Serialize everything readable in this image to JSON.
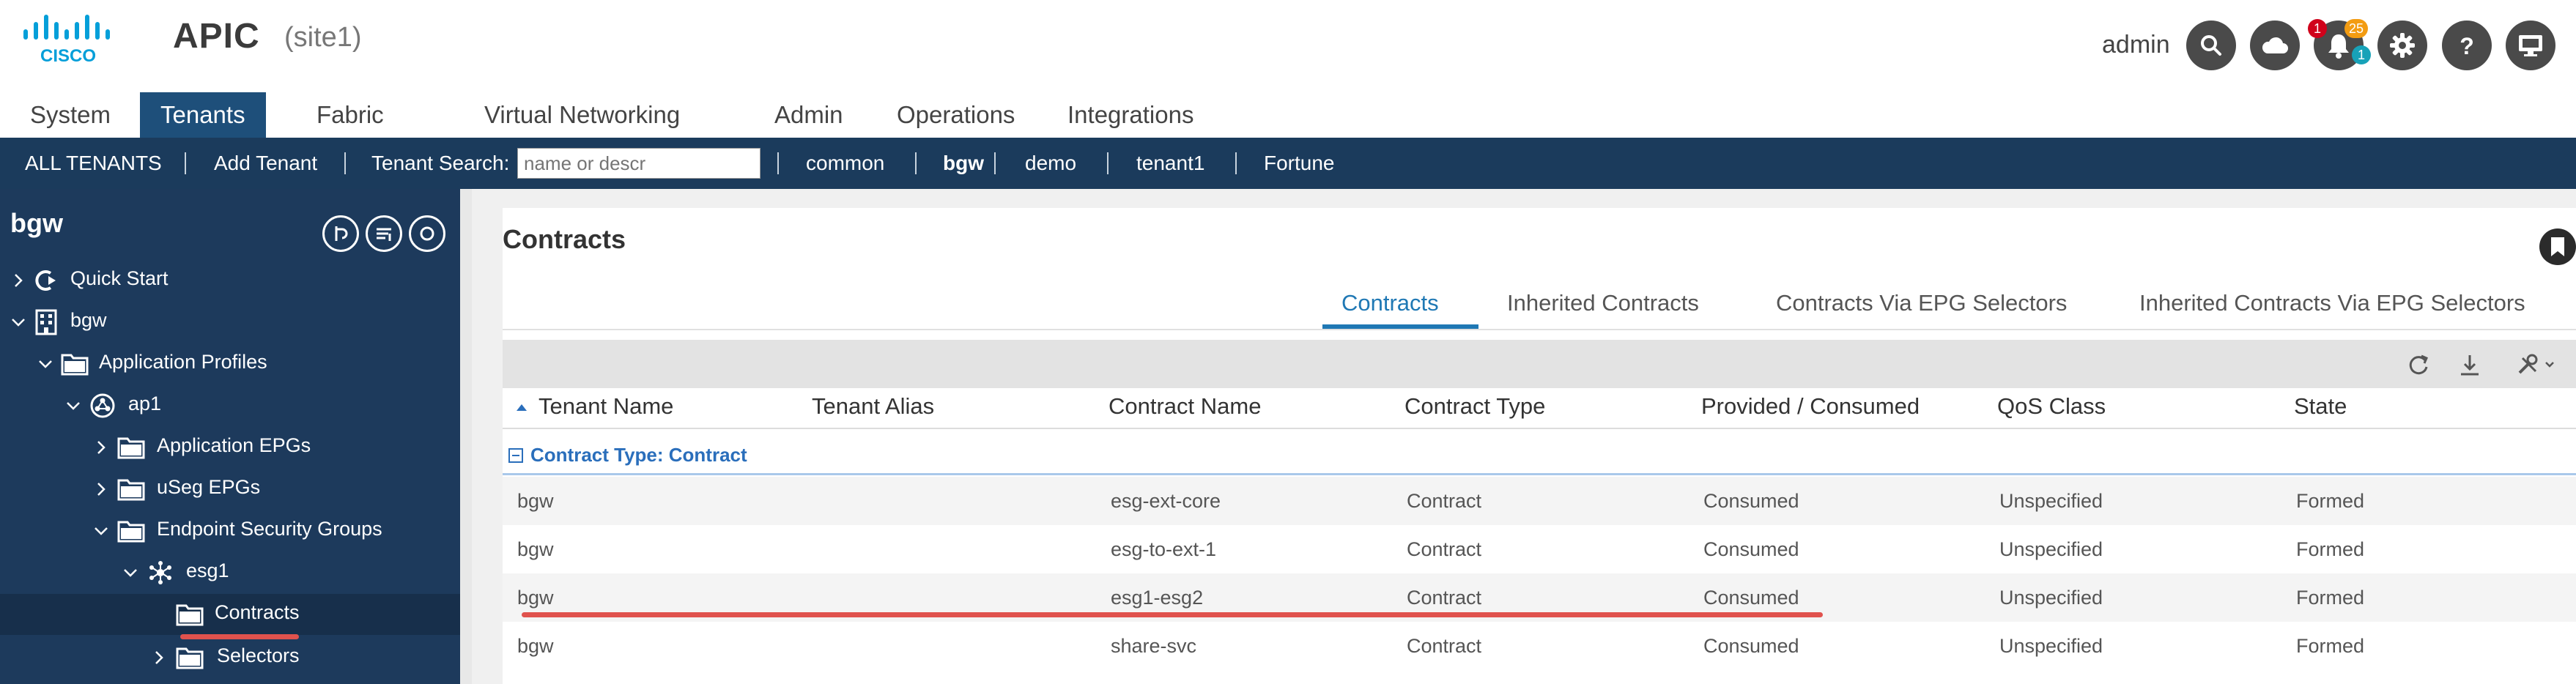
{
  "header": {
    "app_title": "APIC",
    "site": "(site1)",
    "user": "admin",
    "badges": {
      "alerts_red": "1",
      "alerts_orange": "25",
      "alerts_teal": "1"
    },
    "icons": [
      "search-icon",
      "cloud-icon",
      "bell-icon",
      "gear-icon",
      "help-icon",
      "monitor-icon"
    ]
  },
  "main_tabs": [
    "System",
    "Tenants",
    "Fabric",
    "Virtual Networking",
    "Admin",
    "Operations",
    "Integrations"
  ],
  "tenant_bar": {
    "all_tenants": "ALL TENANTS",
    "add_tenant": "Add Tenant",
    "search_label": "Tenant Search:",
    "search_placeholder": "name or descr",
    "tenants": [
      "common",
      "bgw",
      "demo",
      "tenant1",
      "Fortune"
    ]
  },
  "sidebar": {
    "title": "bgw",
    "tree": [
      {
        "label": "Quick Start"
      },
      {
        "label": "bgw"
      },
      {
        "label": "Application Profiles"
      },
      {
        "label": "ap1"
      },
      {
        "label": "Application EPGs"
      },
      {
        "label": "uSeg EPGs"
      },
      {
        "label": "Endpoint Security Groups"
      },
      {
        "label": "esg1"
      },
      {
        "label": "Contracts"
      },
      {
        "label": "Selectors"
      }
    ]
  },
  "content": {
    "title": "Contracts",
    "sub_tabs": [
      "Contracts",
      "Inherited Contracts",
      "Contracts Via EPG Selectors",
      "Inherited Contracts Via EPG Selectors"
    ],
    "columns": [
      "Tenant Name",
      "Tenant Alias",
      "Contract Name",
      "Contract Type",
      "Provided / Consumed",
      "QoS Class",
      "State"
    ],
    "group_label": "Contract Type: Contract",
    "rows": [
      {
        "tenant": "bgw",
        "alias": "",
        "contract": "esg-ext-core",
        "type": "Contract",
        "pc": "Consumed",
        "qos": "Unspecified",
        "state": "Formed"
      },
      {
        "tenant": "bgw",
        "alias": "",
        "contract": "esg-to-ext-1",
        "type": "Contract",
        "pc": "Consumed",
        "qos": "Unspecified",
        "state": "Formed"
      },
      {
        "tenant": "bgw",
        "alias": "",
        "contract": "esg1-esg2",
        "type": "Contract",
        "pc": "Consumed",
        "qos": "Unspecified",
        "state": "Formed"
      },
      {
        "tenant": "bgw",
        "alias": "",
        "contract": "share-svc",
        "type": "Contract",
        "pc": "Consumed",
        "qos": "Unspecified",
        "state": "Formed"
      }
    ]
  },
  "colors": {
    "nav_dark": "#1b3b5c",
    "tab_active": "#1e4f7a",
    "link_blue": "#1f78b4",
    "highlight_red": "#e0524d"
  }
}
